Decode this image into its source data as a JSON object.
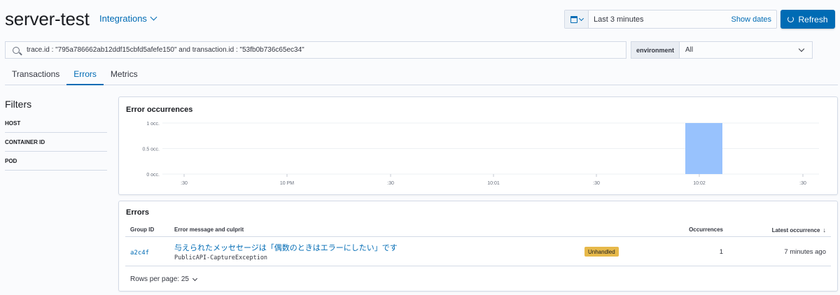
{
  "header": {
    "title": "server-test",
    "integrations_label": "Integrations"
  },
  "datepicker": {
    "range": "Last 3 minutes",
    "show_dates": "Show dates"
  },
  "refresh_label": "Refresh",
  "search": {
    "query": "trace.id : \"795a786662ab12ddf15cbfd5afefe150\" and transaction.id : \"53fb0b736c65ec34\""
  },
  "environment": {
    "label": "environment",
    "value": "All"
  },
  "tabs": [
    {
      "label": "Transactions"
    },
    {
      "label": "Errors"
    },
    {
      "label": "Metrics"
    }
  ],
  "filters": {
    "title": "Filters",
    "items": [
      {
        "label": "HOST"
      },
      {
        "label": "CONTAINER ID"
      },
      {
        "label": "POD"
      }
    ]
  },
  "chart_panel": {
    "title": "Error occurrences"
  },
  "chart_data": {
    "type": "bar",
    "title": "Error occurrences",
    "y_ticks": [
      "1 occ.",
      "0.5 occ.",
      "0 occ."
    ],
    "x_ticks": [
      ":30",
      "10 PM",
      ":30",
      "10:01",
      ":30",
      "10:02",
      ":30"
    ],
    "ylim": [
      0,
      1
    ],
    "series": [
      {
        "x": "10:02",
        "value": 1
      }
    ],
    "bar_color": "#98c2fd",
    "grid": true
  },
  "errors_panel": {
    "title": "Errors",
    "columns": {
      "group_id": "Group ID",
      "message": "Error message and culprit",
      "occurrences": "Occurrences",
      "latest": "Latest occurrence"
    },
    "rows": [
      {
        "group_id": "a2c4f",
        "message": "与えられたメッセセージは「偶数のときはエラーにしたい」です",
        "culprit": "PublicAPI-CaptureException",
        "badge": "Unhandled",
        "occurrences": "1",
        "latest": "7 minutes ago"
      }
    ],
    "rows_per_page": "Rows per page: 25"
  },
  "colors": {
    "accent": "#006bb4",
    "bar": "#98c2fd",
    "badge": "#e7b94a"
  }
}
